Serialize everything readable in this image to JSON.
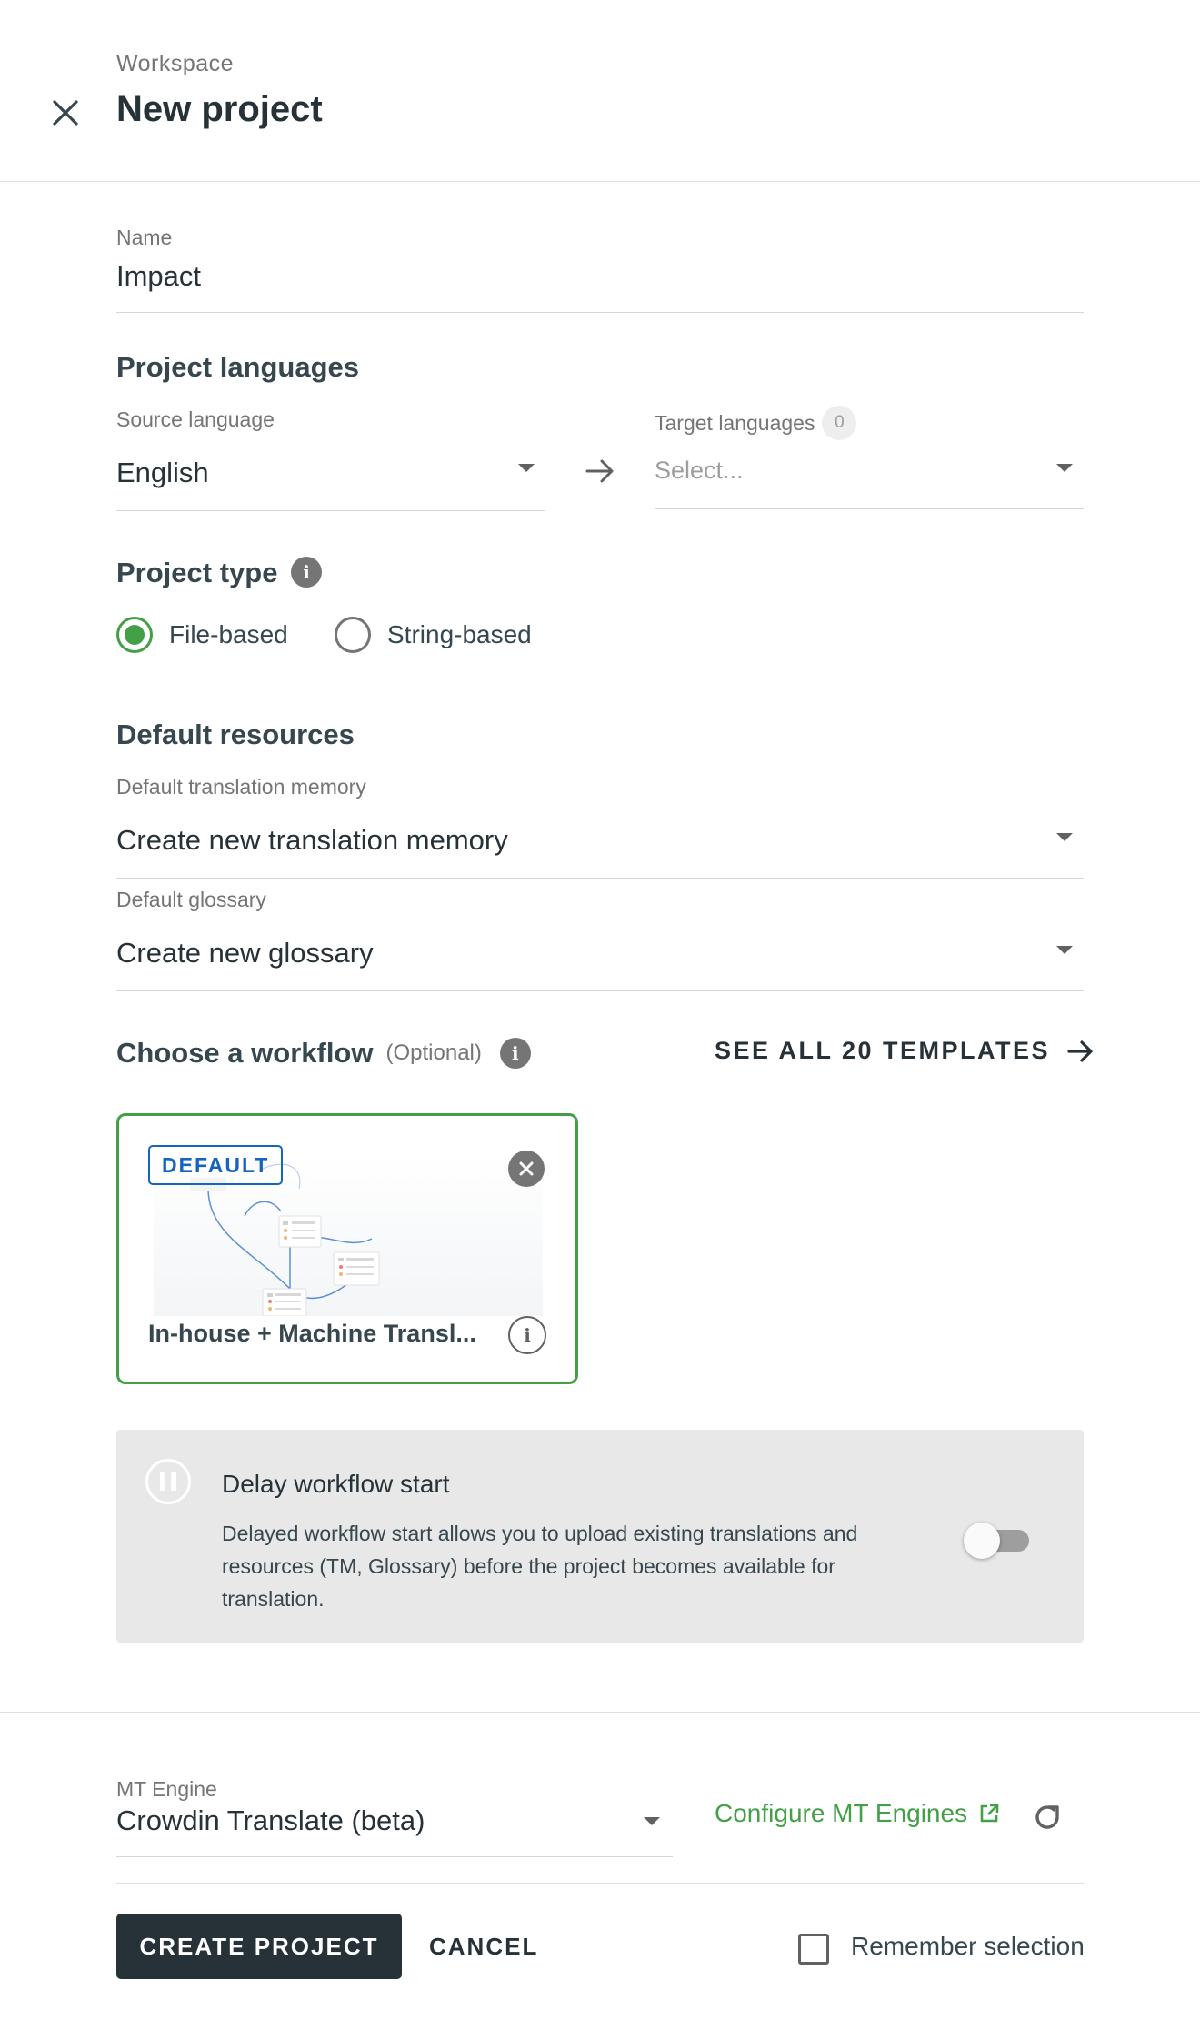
{
  "header": {
    "breadcrumb": "Workspace",
    "title": "New project"
  },
  "name_field": {
    "label": "Name",
    "value": "Impact"
  },
  "languages": {
    "section_title": "Project languages",
    "source_label": "Source language",
    "source_value": "English",
    "target_label": "Target languages",
    "target_count": "0",
    "target_placeholder": "Select..."
  },
  "project_type": {
    "section_title": "Project type",
    "options": [
      {
        "label": "File-based",
        "selected": true
      },
      {
        "label": "String-based",
        "selected": false
      }
    ]
  },
  "resources": {
    "section_title": "Default resources",
    "tm_label": "Default translation memory",
    "tm_value": "Create new translation memory",
    "glossary_label": "Default glossary",
    "glossary_value": "Create new glossary"
  },
  "workflow": {
    "section_title": "Choose a workflow",
    "optional": "(Optional)",
    "see_all": "SEE ALL 20 TEMPLATES",
    "card": {
      "badge": "DEFAULT",
      "title": "In-house + Machine Transl..."
    }
  },
  "delay": {
    "title": "Delay workflow start",
    "description": "Delayed workflow start allows you to upload existing translations and resources (TM, Glossary) before the project becomes available for translation.",
    "enabled": false
  },
  "mt": {
    "label": "MT Engine",
    "value": "Crowdin Translate (beta)",
    "configure_link": "Configure MT Engines"
  },
  "footer": {
    "create_label": "CREATE PROJECT",
    "cancel_label": "CANCEL",
    "remember_label": "Remember selection",
    "remember_checked": false
  },
  "colors": {
    "accent_green": "#43a047",
    "link_green": "#43a047",
    "badge_blue": "#1565c0",
    "primary_button": "#263238"
  }
}
